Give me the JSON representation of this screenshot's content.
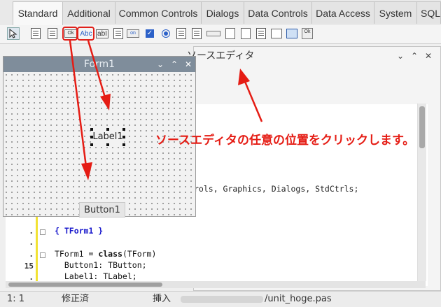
{
  "tabs": [
    "Standard",
    "Additional",
    "Common Controls",
    "Dialogs",
    "Data Controls",
    "Data Access",
    "System",
    "SQLd"
  ],
  "palette": {
    "ok_button_caption": "Ok",
    "label_caption": "Abc",
    "edit_caption": "abI",
    "toggle_caption": "on"
  },
  "form1": {
    "title": "Form1",
    "label_caption": "Label1",
    "button_caption": "Button1"
  },
  "editor": {
    "title": "ソースエディタ",
    "partial_uses_line": "rols, Graphics, Dialogs, StdCtrls;",
    "gutter": [
      ".",
      ".",
      ".",
      "15",
      "."
    ],
    "lines": [
      {
        "a": "{ TForm1 }",
        "b": "",
        "c": ""
      },
      {
        "a": "",
        "b": "",
        "c": ""
      },
      {
        "a": "TForm1 = ",
        "b": "class",
        "c": "(TForm)"
      },
      {
        "a": "  Button1: TButton;",
        "b": "",
        "c": ""
      },
      {
        "a": "  Label1: TLabel;",
        "b": "",
        "c": ""
      }
    ]
  },
  "annotation": "ソースエディタの任意の位置をクリックします。",
  "status": {
    "position": "1:  1",
    "modified": "修正済",
    "mode": "挿入",
    "file": "/unit_hoge.pas"
  },
  "colors": {
    "annotation": "#e51c14",
    "form_titlebar": "#7f8d9b",
    "gutter_marker": "#f2e233"
  }
}
